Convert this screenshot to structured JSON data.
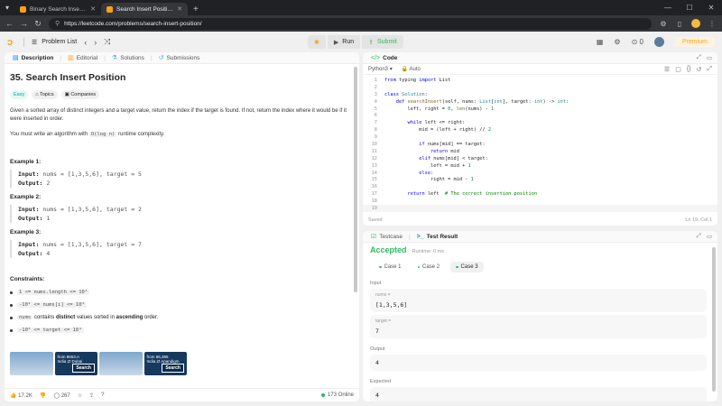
{
  "browser": {
    "tabs": [
      {
        "label": "Binary Search Insertion"
      },
      {
        "label": "Search Insert Position - LeetCo..."
      }
    ],
    "url": "https://leetcode.com/problems/search-insert-position/"
  },
  "nav": {
    "problem_list": "Problem List",
    "run": "Run",
    "submit": "Submit",
    "coins": "0",
    "premium": "Premium"
  },
  "left": {
    "tabs": {
      "description": "Description",
      "editorial": "Editorial",
      "solutions": "Solutions",
      "submissions": "Submissions"
    },
    "title": "35. Search Insert Position",
    "tags": {
      "difficulty": "Easy",
      "topics": "Topics",
      "companies": "Companies"
    },
    "para1": "Given a sorted array of distinct integers and a target value, return the index if the target is found. If not, return the index where it would be if it were inserted in order.",
    "para2_pre": "You must write an algorithm with ",
    "para2_code": "O(log n)",
    "para2_post": " runtime complexity.",
    "examples": [
      {
        "title": "Example 1:",
        "input_label": "Input:",
        "input": " nums = [1,3,5,6], target = 5",
        "output_label": "Output:",
        "output": " 2"
      },
      {
        "title": "Example 2:",
        "input_label": "Input:",
        "input": " nums = [1,3,5,6], target = 2",
        "output_label": "Output:",
        "output": " 1"
      },
      {
        "title": "Example 3:",
        "input_label": "Input:",
        "input": " nums = [1,3,5,6], target = 7",
        "output_label": "Output:",
        "output": " 4"
      }
    ],
    "constraints_title": "Constraints:",
    "constraints": {
      "c1": "1 <= nums.length <= 10⁴",
      "c2": "-10⁴ <= nums[i] <= 10⁴",
      "c3_code": "nums",
      "c3_pre": " contains ",
      "c3_b1": "distinct",
      "c3_mid": " values sorted in ",
      "c3_b2": "ascending",
      "c3_post": " order.",
      "c4": "-10⁴ <= target <= 10⁴"
    },
    "ad": {
      "t1": "from 8653.A",
      "t2": "India ⇄ Dubai",
      "b1": "Search",
      "t3": "from 66,365",
      "t4": "India ⇄ Apandigm",
      "b2": "Search"
    },
    "footer": {
      "likes": "17.2K",
      "comments": "267",
      "online": "173 Online"
    }
  },
  "code": {
    "tab": "Code",
    "lang": "Python3",
    "mode": "Auto",
    "lines": [
      "1",
      "2",
      "3",
      "4",
      "5",
      "6",
      "7",
      "8",
      "9",
      "10",
      "11",
      "12",
      "13",
      "14",
      "15",
      "16",
      "17",
      "18",
      "19"
    ],
    "saved": "Saved",
    "cursor": "Ln 19, Col 1"
  },
  "result": {
    "tabs": {
      "testcase": "Testcase",
      "result": "Test Result"
    },
    "status": "Accepted",
    "runtime": "Runtime: 0 ms",
    "cases": [
      "Case 1",
      "Case 2",
      "Case 3"
    ],
    "input_label": "Input",
    "nums_key": "nums =",
    "nums_val": "[1,3,5,6]",
    "target_key": "target =",
    "target_val": "7",
    "output_label": "Output",
    "output_val": "4",
    "expected_label": "Expected",
    "expected_val": "4"
  }
}
